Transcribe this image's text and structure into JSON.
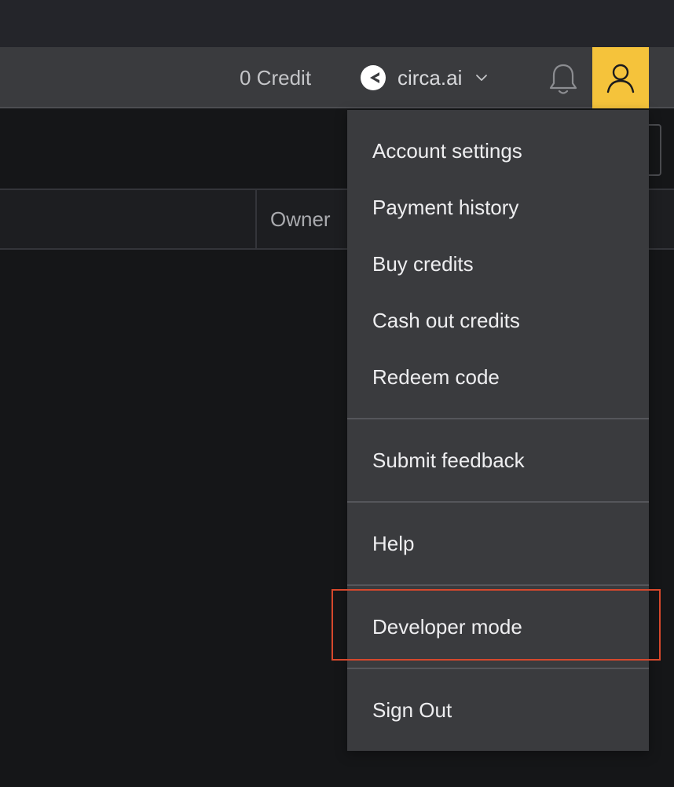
{
  "header": {
    "credit_label": "0 Credit",
    "org_name": "circa.ai",
    "org_logo_icon": "circa-logo-icon",
    "notifications_icon": "bell-icon",
    "account_icon": "user-icon",
    "accent_color": "#f5c33b"
  },
  "table": {
    "columns": [
      "Owner"
    ]
  },
  "user_menu": {
    "items": [
      "Account settings",
      "Payment history",
      "Buy credits",
      "Cash out credits",
      "Redeem code",
      "Submit feedback",
      "Help",
      "Developer mode",
      "Sign Out"
    ],
    "highlight_color": "#d6482c"
  }
}
